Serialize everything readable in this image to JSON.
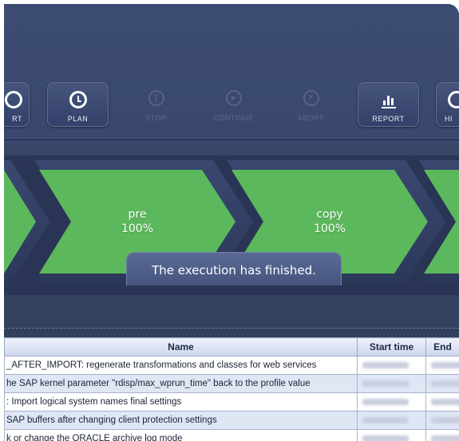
{
  "toolbar": {
    "buttons": [
      {
        "label": "RT",
        "icon": "start-icon",
        "enabled": true
      },
      {
        "label": "PLAN",
        "icon": "clock-icon",
        "enabled": true
      },
      {
        "label": "STOP",
        "icon": "stop-icon",
        "enabled": false
      },
      {
        "label": "CONTINUE",
        "icon": "play-icon",
        "enabled": false
      },
      {
        "label": "ABORT",
        "icon": "abort-icon",
        "enabled": false
      },
      {
        "label": "REPORT",
        "icon": "bar-chart-icon",
        "enabled": true
      },
      {
        "label": "HI",
        "icon": "history-icon",
        "enabled": true
      }
    ]
  },
  "phases": [
    {
      "name": "pre",
      "progress": "100%",
      "status_color": "#5cb85c"
    },
    {
      "name": "copy",
      "progress": "100%",
      "status_color": "#5cb85c"
    }
  ],
  "toast": {
    "message": "The execution has finished."
  },
  "table": {
    "columns": [
      "Name",
      "Start time",
      "End"
    ],
    "rows": [
      {
        "name": "_AFTER_IMPORT: regenerate transformations and classes for web services"
      },
      {
        "name": "he SAP kernel parameter \"rdisp/max_wprun_time\" back to the profile value"
      },
      {
        "name": ": Import logical system names final settings"
      },
      {
        "name": "SAP buffers after changing client protection settings"
      },
      {
        "name": "k or change the ORACLE archive log mode"
      }
    ]
  },
  "colors": {
    "background": "#3b4a70",
    "phase_done": "#5cb85c",
    "header_bg": "#dbe2f2"
  }
}
